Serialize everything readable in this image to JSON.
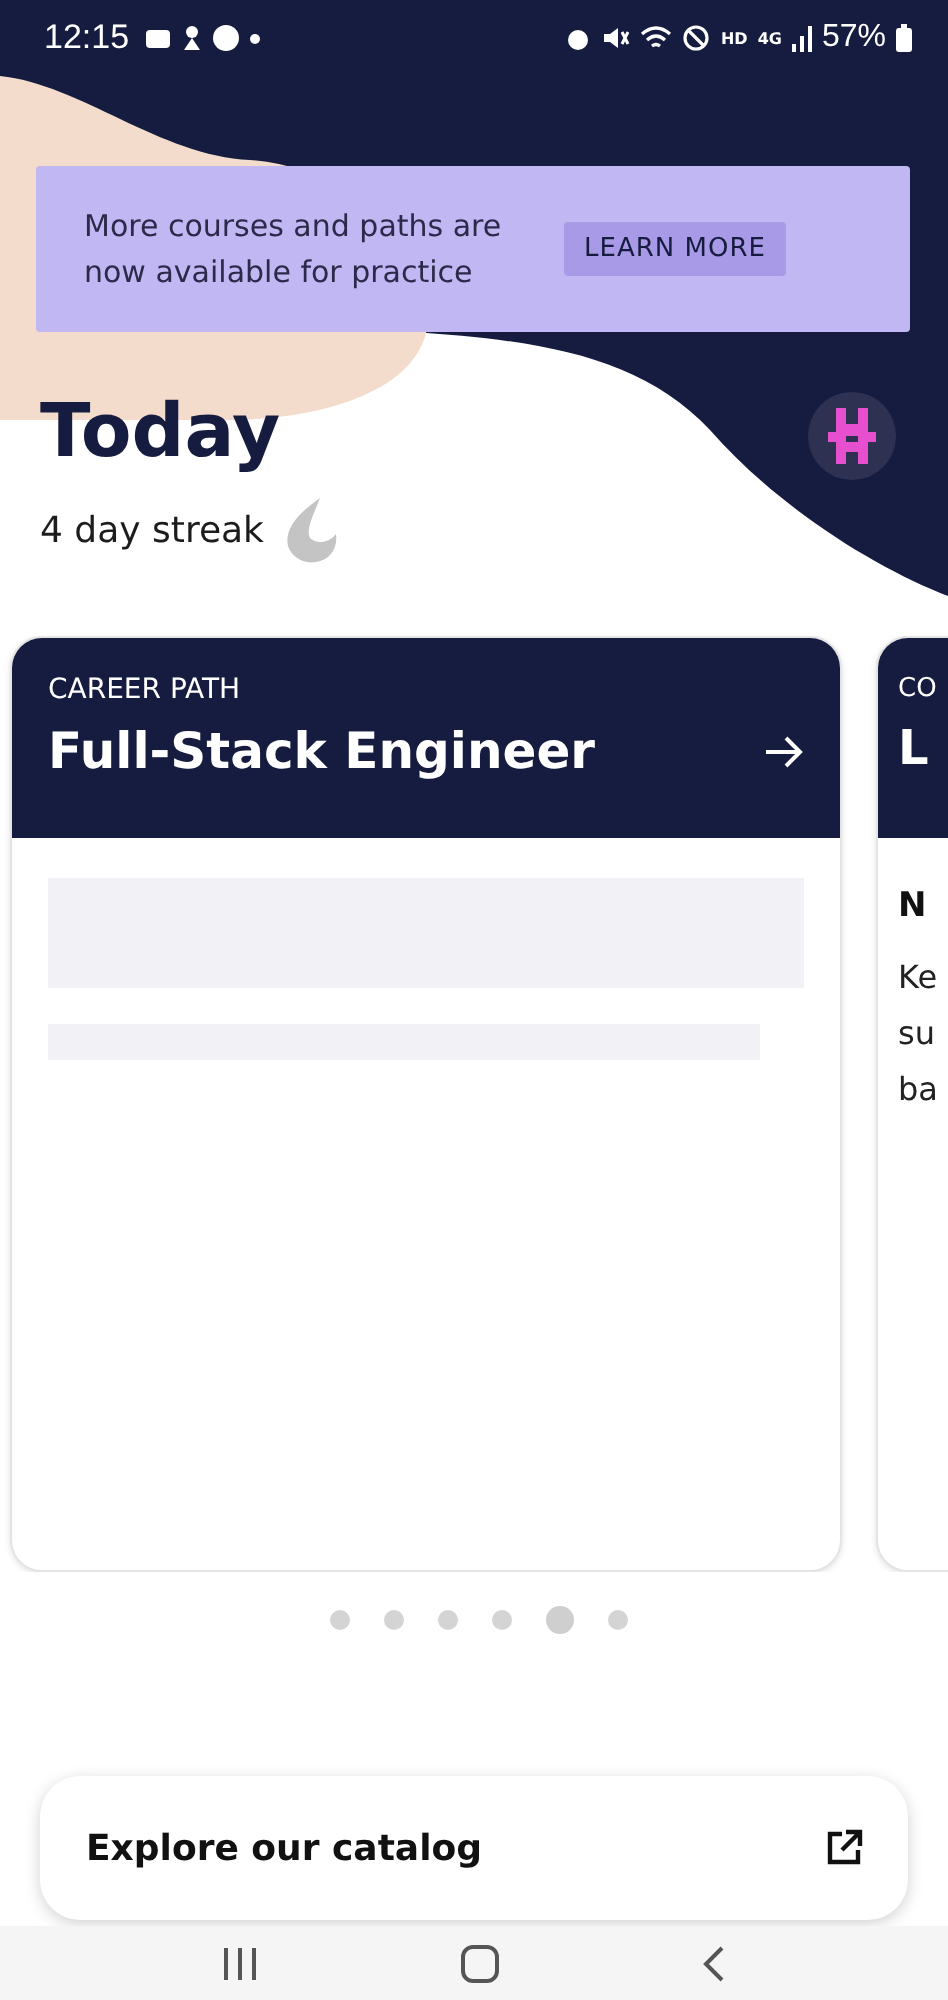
{
  "status_bar": {
    "time": "12:15",
    "hd": "HD",
    "network": "4G",
    "battery": "57%"
  },
  "banner": {
    "text": "More courses and paths are now available for practice",
    "button": "LEARN MORE"
  },
  "header": {
    "title": "Today",
    "streak": "4 day streak"
  },
  "cards": [
    {
      "label": "CAREER PATH",
      "title": "Full-Stack Engineer",
      "kind": "skeleton"
    },
    {
      "label": "CO",
      "title": "L",
      "subtitle": "N",
      "body": [
        "Ke",
        "su",
        "ba"
      ],
      "kind": "text"
    }
  ],
  "pager": [
    {
      "selected": false
    },
    {
      "selected": false
    },
    {
      "selected": false
    },
    {
      "selected": false
    },
    {
      "selected": true
    },
    {
      "selected": false
    }
  ],
  "catalog_button": "Explore our catalog"
}
